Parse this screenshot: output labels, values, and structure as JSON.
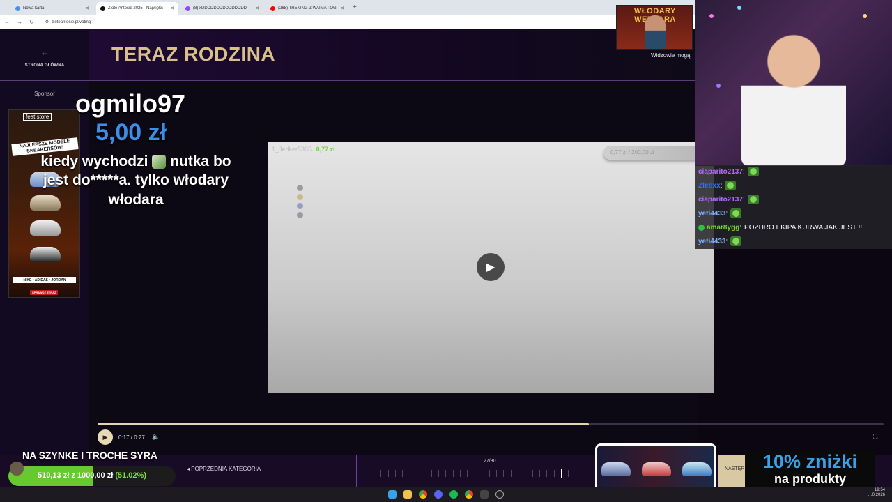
{
  "browser": {
    "tabs": [
      {
        "title": "Nowa karta",
        "favicon_color": "#4a8ff0",
        "active": false
      },
      {
        "title": "Złote Antosie 2025 - Najwięks",
        "favicon_color": "#111111",
        "active": true
      },
      {
        "title": "(8) xDDDDDDDDDDDDDDD",
        "favicon_color": "#9146ff",
        "active": false
      },
      {
        "title": "(268) TRENING Z WAIMA I OG",
        "favicon_color": "#ff0000",
        "active": false
      }
    ],
    "url": "zloteantosie.pl/voting"
  },
  "site": {
    "home_label": "STRONA GŁÓWNA",
    "sponsor_label": "Sponsor",
    "page_title": "TERAZ RODZINA",
    "ad": {
      "logo": "feat.store",
      "headline": "NAJLEPSZE MODELE SNEAKERSÓW!",
      "brands": "NIKE • ADIDAS • JORDAN",
      "cta": "SPRAWDŹ TERAZ"
    },
    "video": {
      "donor": "1_Jedker5365",
      "donor_amount": "0,77 zł",
      "progress": "0,77 zł / 200,00 zł",
      "play_icon": "play-icon"
    },
    "player": {
      "time": "0:17 / 0:27",
      "progress_fraction": 0.625
    },
    "nav": {
      "prev_label": "POPRZEDNIA KATEGORIA",
      "counter": "27/30",
      "current": 27,
      "total": 30,
      "next_label": "NASTĘP"
    }
  },
  "donation": {
    "username": "ogmilo97",
    "amount": "5,00 zł",
    "message_part1": "kiedy wychodzi",
    "message_part2": "nutka bo jest do*****a. tylko włodary włodara"
  },
  "goal": {
    "title": "NA SZYNKE I TROCHE SYRA",
    "current": "510,13 zł",
    "separator": "z",
    "target": "1000,00 zł",
    "percent_text": "(51.02%)",
    "fraction": 0.5102
  },
  "stream": {
    "poster_title": "WŁODARY WEDŁARA",
    "viewers_text": "Widzowie mogą",
    "chat": [
      {
        "user": "ciaparito2137",
        "color": "#b36bff",
        "message": "",
        "badge": false
      },
      {
        "user": "Zletixx",
        "color": "#3b6bff",
        "message": "",
        "badge": false
      },
      {
        "user": "ciaparito2137",
        "color": "#b36bff",
        "message": "",
        "badge": false
      },
      {
        "user": "yeti4433",
        "color": "#7fb2ff",
        "message": "",
        "badge": false
      },
      {
        "user": "amar8ygg",
        "color": "#6fd43a",
        "message": "POZDRO EKIPA KURWA JAK JEST !!",
        "badge": true
      },
      {
        "user": "yeti4433",
        "color": "#7fb2ff",
        "message": "",
        "badge": false
      }
    ],
    "promo_big": "10% zniżki",
    "promo_small": "na produkty"
  },
  "taskbar": {
    "time": "19:54",
    "date": "…0.2026",
    "icons": [
      "windows-icon",
      "folder-icon",
      "chrome-icon",
      "discord-icon",
      "spotify-icon",
      "chrome-alt-icon",
      "app-icon",
      "obs-icon"
    ]
  },
  "colors": {
    "accent_gold": "#d7c08c",
    "amount_blue": "#3b8fe8",
    "goal_green": "#67c92d",
    "nav_purple": "#6b3fa0"
  }
}
